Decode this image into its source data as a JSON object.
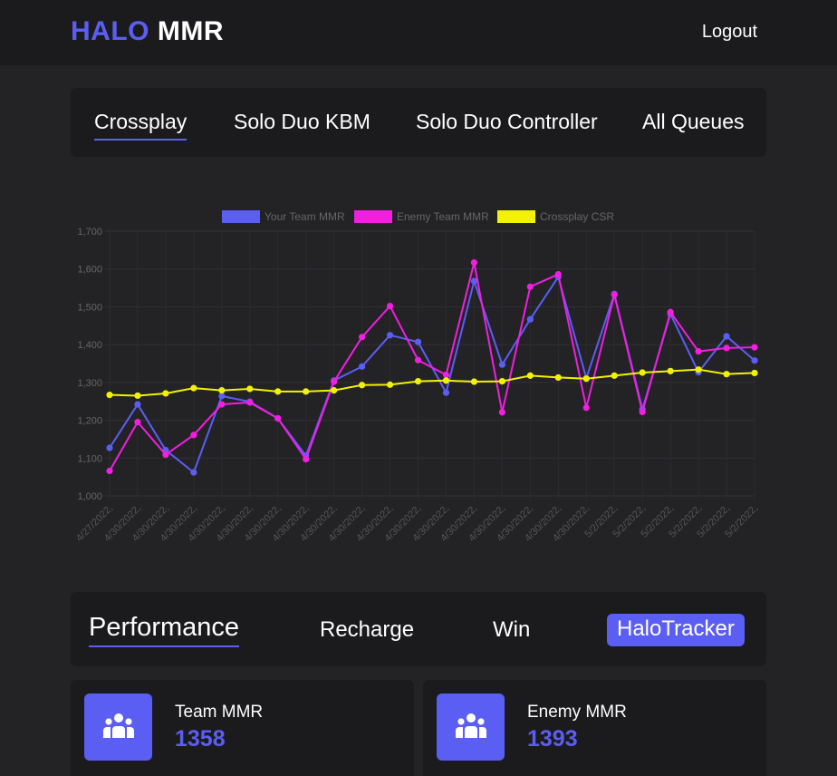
{
  "header": {
    "brand_halo": "HALO",
    "brand_mmr": "MMR",
    "logout_label": "Logout"
  },
  "queue_tabs": [
    {
      "label": "Crossplay",
      "active": true
    },
    {
      "label": "Solo Duo KBM",
      "active": false
    },
    {
      "label": "Solo Duo Controller",
      "active": false
    },
    {
      "label": "All Queues",
      "active": false
    }
  ],
  "chart_data": {
    "type": "line",
    "categories": [
      "4/27/2022,",
      "4/30/2022,",
      "4/30/2022,",
      "4/30/2022,",
      "4/30/2022,",
      "4/30/2022,",
      "4/30/2022,",
      "4/30/2022,",
      "4/30/2022,",
      "4/30/2022,",
      "4/30/2022,",
      "4/30/2022,",
      "4/30/2022,",
      "4/30/2022,",
      "4/30/2022,",
      "4/30/2022,",
      "4/30/2022,",
      "4/30/2022,",
      "5/2/2022,",
      "5/2/2022,",
      "5/2/2022,",
      "5/2/2022,",
      "5/2/2022,",
      "5/2/2022,"
    ],
    "series": [
      {
        "name": "Your Team MMR",
        "color": "#5b5ef2",
        "values": [
          1127,
          1242,
          1121,
          1062,
          1264,
          1249,
          1205,
          1106,
          1305,
          1342,
          1425,
          1407,
          1273,
          1568,
          1347,
          1467,
          1579,
          1311,
          1534,
          1229,
          1481,
          1327,
          1422,
          1358
        ]
      },
      {
        "name": "Enemy Team MMR",
        "color": "#f21ee0",
        "values": [
          1066,
          1195,
          1109,
          1161,
          1242,
          1247,
          1205,
          1097,
          1302,
          1420,
          1502,
          1359,
          1320,
          1617,
          1221,
          1553,
          1586,
          1233,
          1532,
          1222,
          1486,
          1382,
          1391,
          1393
        ]
      },
      {
        "name": "Crossplay CSR",
        "color": "#f2f200",
        "values": [
          1267,
          1265,
          1271,
          1285,
          1279,
          1283,
          1276,
          1276,
          1279,
          1293,
          1294,
          1303,
          1305,
          1302,
          1303,
          1318,
          1313,
          1310,
          1318,
          1326,
          1330,
          1334,
          1322,
          1325
        ]
      }
    ],
    "ylim": [
      1000,
      1700
    ],
    "yticks": [
      "1,000",
      "1,100",
      "1,200",
      "1,300",
      "1,400",
      "1,500",
      "1,600",
      "1,700"
    ],
    "grid": true,
    "legend": "top"
  },
  "perf_tabs": {
    "performance": "Performance",
    "recharge": "Recharge",
    "win": "Win",
    "halotracker": "HaloTracker"
  },
  "cards": {
    "team": {
      "label": "Team MMR",
      "value": "1358",
      "icon": "users-icon"
    },
    "enemy": {
      "label": "Enemy MMR",
      "value": "1393",
      "icon": "users-icon"
    }
  },
  "colors": {
    "accent": "#5b5ef2",
    "background": "#232326",
    "panel": "#1b1b1e"
  }
}
